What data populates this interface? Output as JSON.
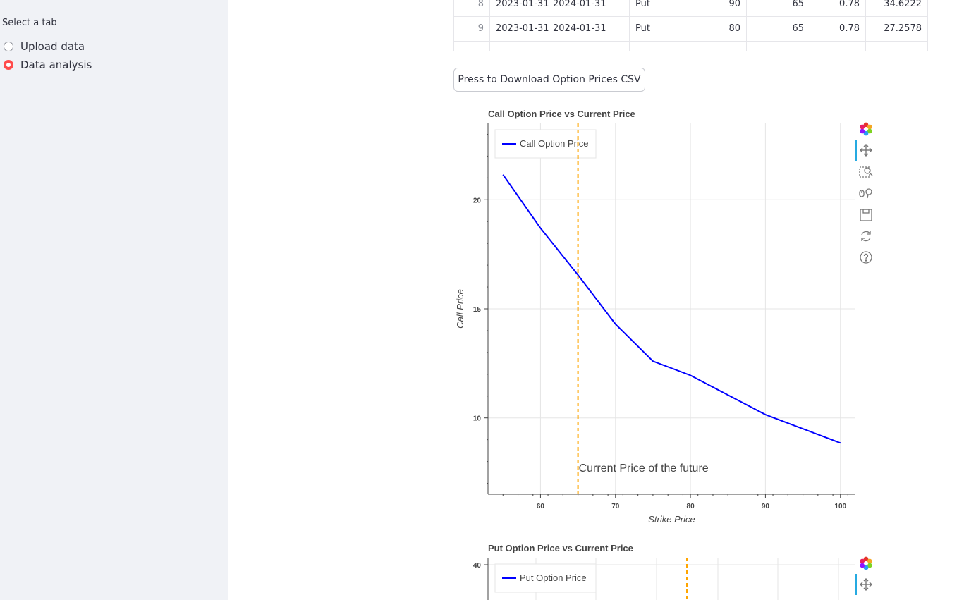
{
  "sidebar": {
    "label": "Select a tab",
    "options": [
      {
        "label": "Upload data",
        "selected": false
      },
      {
        "label": "Data analysis",
        "selected": true
      }
    ],
    "accent_color": "#ff4b4b"
  },
  "table": {
    "rows": [
      {
        "index": "8",
        "start": "2023-01-31",
        "end": "2024-01-31",
        "type": "Put",
        "strike": "90",
        "current": "65",
        "vol": "0.78",
        "price": "34.6222"
      },
      {
        "index": "9",
        "start": "2023-01-31",
        "end": "2024-01-31",
        "type": "Put",
        "strike": "80",
        "current": "65",
        "vol": "0.78",
        "price": "27.2578"
      }
    ]
  },
  "download_button": {
    "label": "Press to Download Option Prices CSV"
  },
  "toolbar": {
    "icons": [
      "bokeh-logo-icon",
      "pan-icon",
      "box-zoom-icon",
      "wheel-zoom-icon",
      "save-icon",
      "reset-icon",
      "help-icon"
    ]
  },
  "chart_data": [
    {
      "type": "line",
      "title": "Call Option Price vs Current Price",
      "xlabel": "Strike Price",
      "ylabel": "Call Price",
      "xlim": [
        53,
        102
      ],
      "ylim": [
        6.5,
        23.5
      ],
      "x_ticks": [
        60,
        70,
        80,
        90,
        100
      ],
      "y_ticks": [
        10,
        15,
        20
      ],
      "grid": true,
      "legend_position": "top-left",
      "series": [
        {
          "name": "Call Option Price",
          "color": "#0000ff",
          "x": [
            55,
            60,
            65,
            70,
            75,
            80,
            85,
            90,
            95,
            100
          ],
          "values": [
            21.15,
            18.7,
            16.55,
            14.3,
            12.6,
            11.95,
            11.05,
            10.15,
            9.5,
            8.85
          ]
        }
      ],
      "vline": {
        "x": 65,
        "color": "#ffa500",
        "label": "Current Price of the future"
      }
    },
    {
      "type": "line",
      "title": "Put Option Price vs Current Price",
      "xlabel": "",
      "ylabel": "",
      "y_ticks": [
        40
      ],
      "grid": true,
      "legend_position": "top-left",
      "series": [
        {
          "name": "Put Option Price",
          "color": "#0000ff"
        }
      ],
      "vline": {
        "color": "#ffa500"
      }
    }
  ]
}
